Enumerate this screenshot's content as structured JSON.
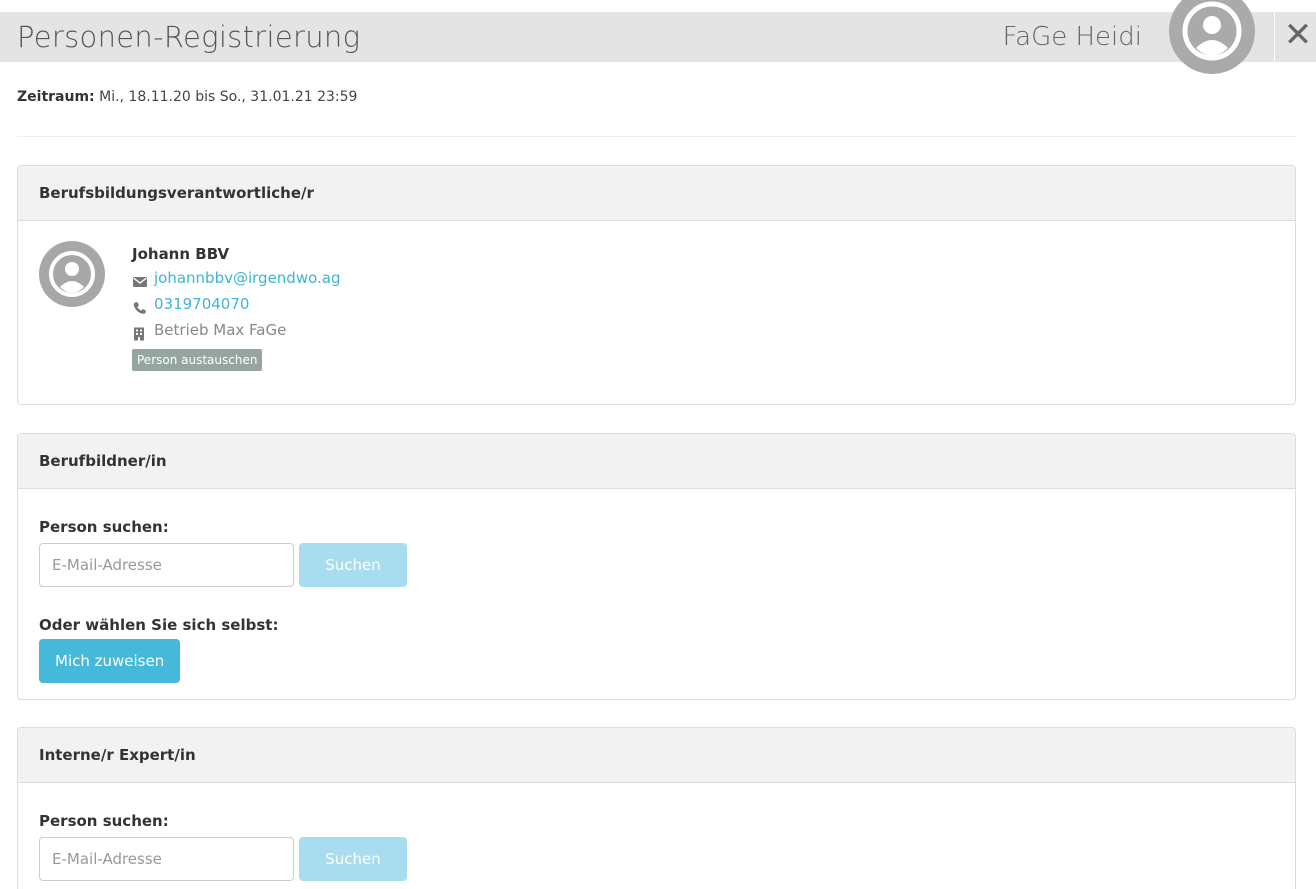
{
  "header": {
    "title": "Personen-Registrierung",
    "user_name": "FaGe Heidi",
    "close_glyph": "✕",
    "avatar_icon": "user-avatar-icon",
    "background": "#e3e4e3"
  },
  "period": {
    "label": "Zeitraum:",
    "value": "Mi., 18.11.20 bis So., 31.01.21 23:59"
  },
  "panels": {
    "vocational_training_manager": {
      "heading": "Berufsbildungsverantwortliche/r",
      "person": {
        "name": "Johann BBV",
        "email": "johannbbv@irgendwo.ag",
        "phone": "0319704070",
        "company": "Betrieb Max FaGe",
        "icons": [
          "envelope-icon",
          "phone-icon",
          "building-icon"
        ],
        "swap_button": "Person austauschen"
      }
    },
    "trainer": {
      "heading": "Berufbildner/in",
      "search_label": "Person suchen:",
      "search_placeholder": "E-Mail-Adresse",
      "search_button": "Suchen",
      "self_label": "Oder wählen Sie sich selbst:",
      "self_button": "Mich zuweisen"
    },
    "internal_expert": {
      "heading": "Interne/r Expert/in",
      "search_label": "Person suchen:",
      "search_placeholder": "E-Mail-Adresse",
      "search_button": "Suchen"
    }
  },
  "colors": {
    "accent": "#46b8da",
    "accent_disabled": "#a8ddef",
    "link": "#3eb4d6",
    "swap_button": "#95a5a0",
    "panel_heading_bg": "#f2f2f2"
  }
}
